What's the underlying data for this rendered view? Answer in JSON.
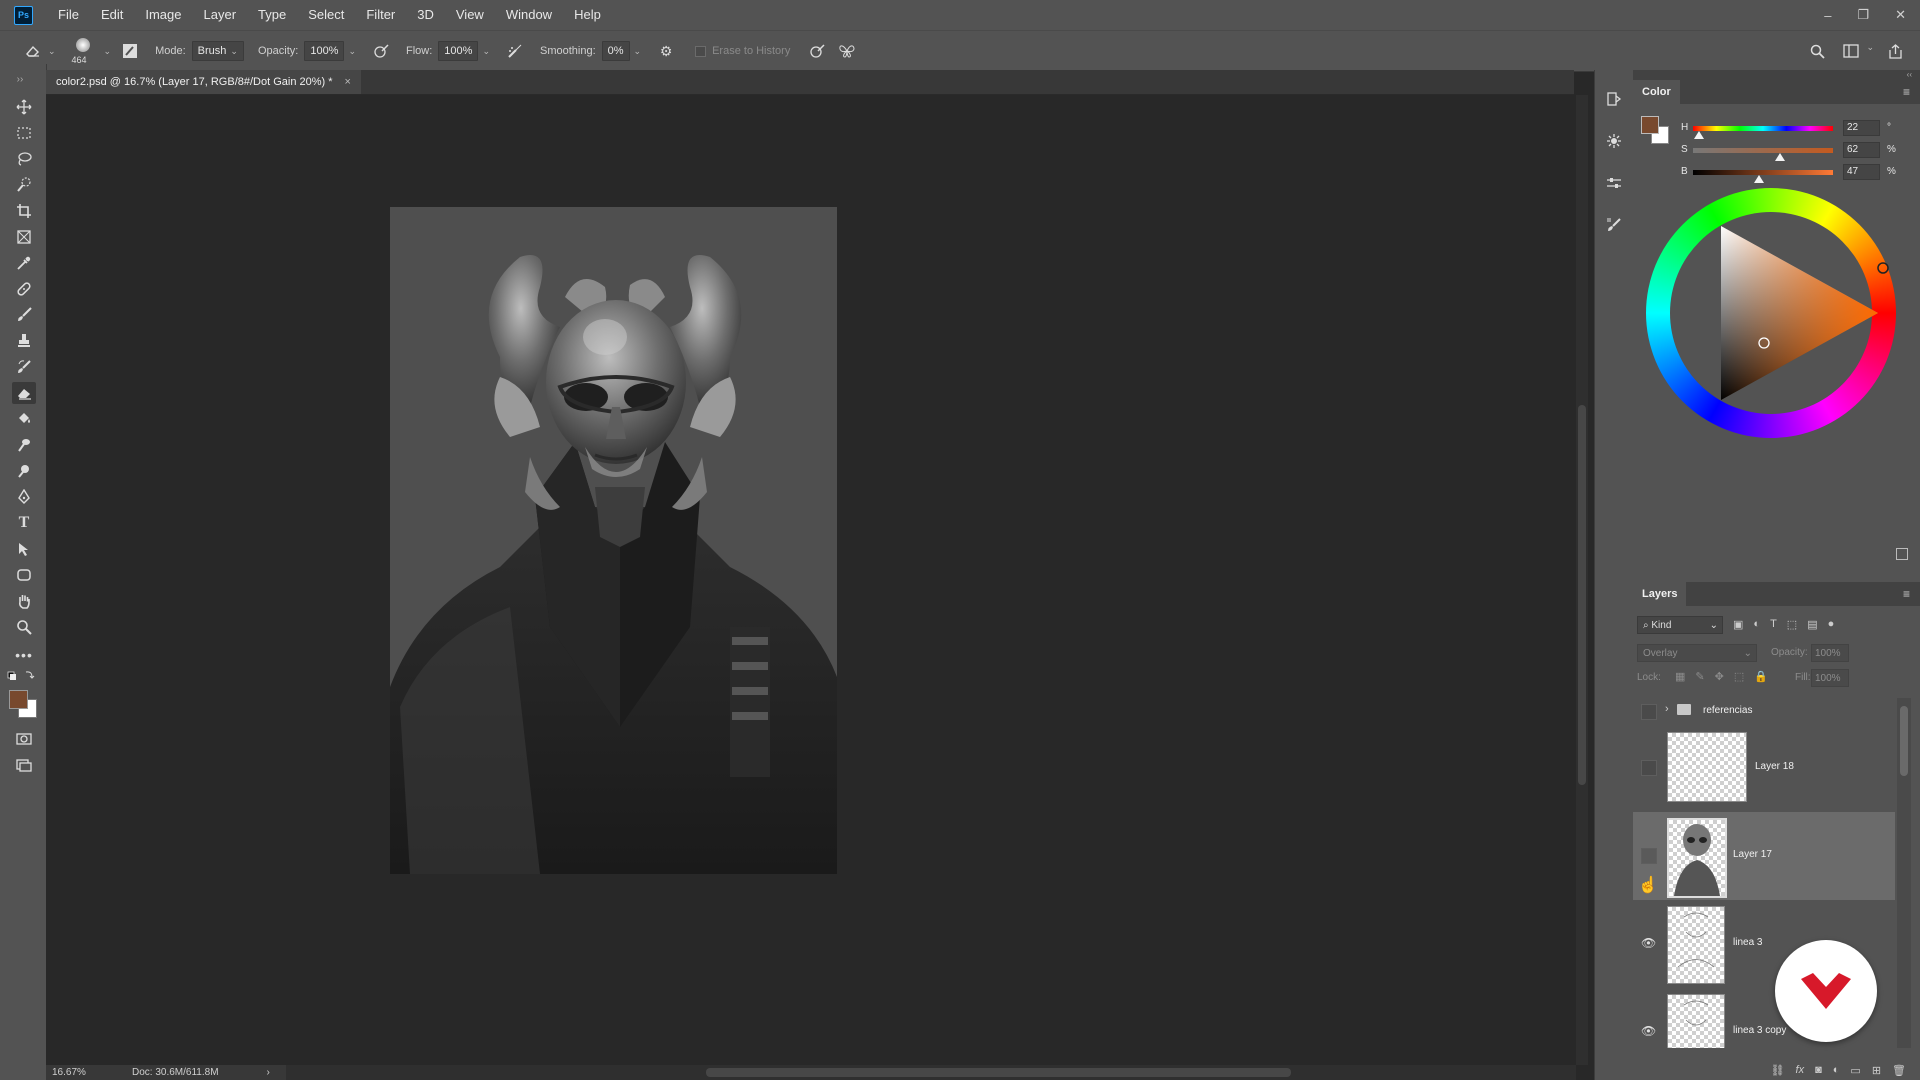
{
  "app": {
    "logo": "Ps"
  },
  "menu": [
    "File",
    "Edit",
    "Image",
    "Layer",
    "Type",
    "Select",
    "Filter",
    "3D",
    "View",
    "Window",
    "Help"
  ],
  "window_controls": [
    "–",
    "❐",
    "✕"
  ],
  "options": {
    "brush_size": "464",
    "mode_label": "Mode:",
    "mode_value": "Brush",
    "opacity_label": "Opacity:",
    "opacity_value": "100%",
    "flow_label": "Flow:",
    "flow_value": "100%",
    "smoothing_label": "Smoothing:",
    "smoothing_value": "0%",
    "erase_history": "Erase to History"
  },
  "document_tab": {
    "title": "color2.psd @ 16.7% (Layer 17, RGB/8#/Dot Gain 20%) *",
    "close": "×"
  },
  "status": {
    "zoom": "16.67%",
    "doc": "Doc: 30.6M/611.8M",
    "arrow": "›"
  },
  "color_panel": {
    "title": "Color",
    "h_label": "H",
    "h_value": "22",
    "h_unit": "°",
    "s_label": "S",
    "s_value": "62",
    "s_unit": "%",
    "b_label": "B",
    "b_value": "47",
    "b_unit": "%",
    "foreground_color": "#78492e",
    "background_color": "#ffffff"
  },
  "layers_panel": {
    "title": "Layers",
    "filter_label": "Kind",
    "blend_mode": "Overlay",
    "opacity_label": "Opacity:",
    "opacity_value": "100%",
    "lock_label": "Lock:",
    "fill_label": "Fill:",
    "fill_value": "100%",
    "layers": [
      {
        "name": "referencias",
        "type": "group",
        "visible": false
      },
      {
        "name": "Layer 18",
        "visible": false
      },
      {
        "name": "Layer 17",
        "visible": false,
        "selected": true
      },
      {
        "name": "linea 3",
        "visible": true
      },
      {
        "name": "linea 3 copy",
        "visible": true
      }
    ]
  }
}
